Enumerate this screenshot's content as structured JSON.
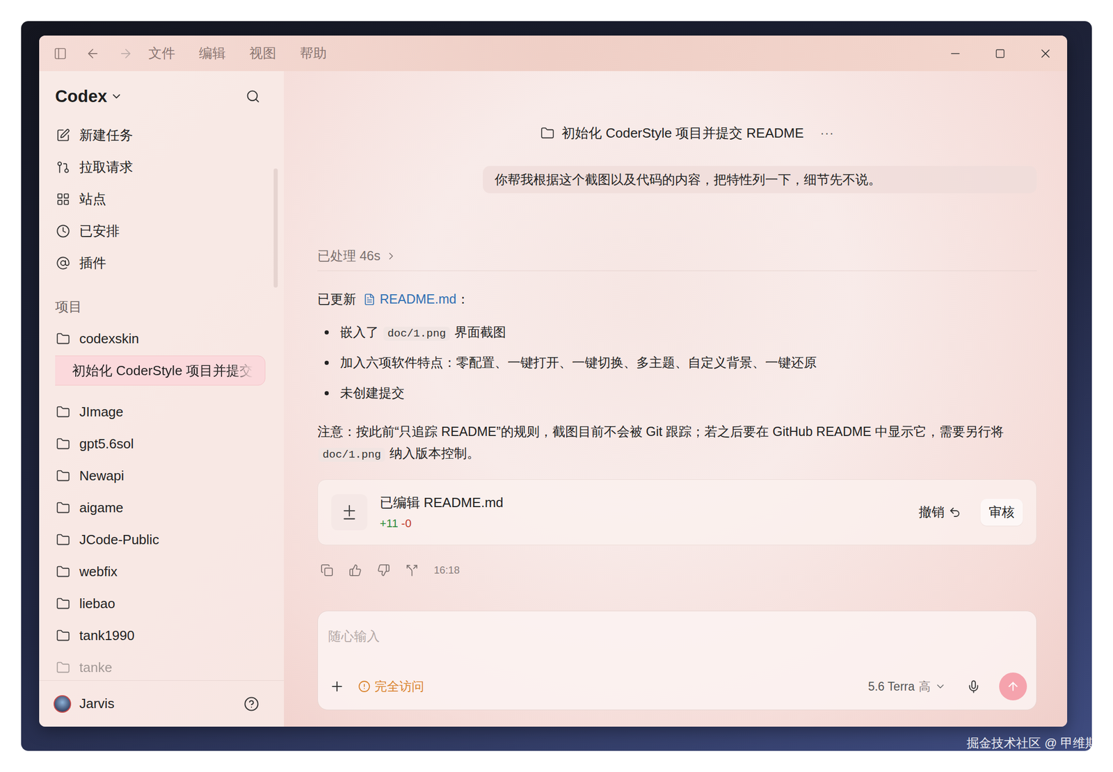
{
  "window": {
    "menu": [
      "文件",
      "编辑",
      "视图",
      "帮助"
    ]
  },
  "sidebar": {
    "app": "Codex",
    "nav": [
      {
        "label": "新建任务"
      },
      {
        "label": "拉取请求"
      },
      {
        "label": "站点"
      },
      {
        "label": "已安排"
      },
      {
        "label": "插件"
      }
    ],
    "projects_label": "项目",
    "projects": [
      {
        "label": "codexskin",
        "kind": "folder",
        "selected": false,
        "dimmed": false
      },
      {
        "label": "初始化 CoderStyle 项目并提交",
        "kind": "thread",
        "selected": true,
        "dimmed": false
      },
      {
        "label": "JImage",
        "kind": "folder",
        "selected": false,
        "dimmed": false
      },
      {
        "label": "gpt5.6sol",
        "kind": "folder",
        "selected": false,
        "dimmed": false
      },
      {
        "label": "Newapi",
        "kind": "folder",
        "selected": false,
        "dimmed": false
      },
      {
        "label": "aigame",
        "kind": "folder",
        "selected": false,
        "dimmed": false
      },
      {
        "label": "JCode-Public",
        "kind": "folder",
        "selected": false,
        "dimmed": false
      },
      {
        "label": "webfix",
        "kind": "folder",
        "selected": false,
        "dimmed": false
      },
      {
        "label": "liebao",
        "kind": "folder",
        "selected": false,
        "dimmed": false
      },
      {
        "label": "tank1990",
        "kind": "folder",
        "selected": false,
        "dimmed": false
      },
      {
        "label": "tanke",
        "kind": "folder",
        "selected": false,
        "dimmed": true
      }
    ],
    "user": "Jarvis"
  },
  "thread": {
    "title": "初始化 CoderStyle 项目并提交 README",
    "more": "···",
    "user_message": "你帮我根据这个截图以及代码的内容，把特性列一下，细节先不说。",
    "processed": "已处理 46s",
    "updated_prefix": "已更新",
    "updated_file": "README.md",
    "updated_suffix": "：",
    "bullets": [
      [
        {
          "text": "嵌入了 "
        },
        {
          "code": "doc/1.png"
        },
        {
          "text": " 界面截图"
        }
      ],
      [
        {
          "text": "加入六项软件特点：零配置、一键打开、一键切换、多主题、自定义背景、一键还原"
        }
      ],
      [
        {
          "text": "未创建提交"
        }
      ]
    ],
    "note": [
      {
        "text": "注意：按此前“只追踪 README”的规则，截图目前不会被 Git 跟踪；若之后要在 GitHub README 中显示它，需要另行将 "
      },
      {
        "code": "doc/1.png"
      },
      {
        "text": " 纳入版本控制。"
      }
    ],
    "edit_card": {
      "title": "已编辑 README.md",
      "added": "+11",
      "removed": "-0",
      "undo": "撤销",
      "review": "审核"
    },
    "time": "16:18"
  },
  "composer": {
    "placeholder": "随心输入",
    "access": "完全访问",
    "model": "5.6 Terra",
    "effort": "高"
  },
  "watermark": "掘金技术社区 @ 甲维斯"
}
